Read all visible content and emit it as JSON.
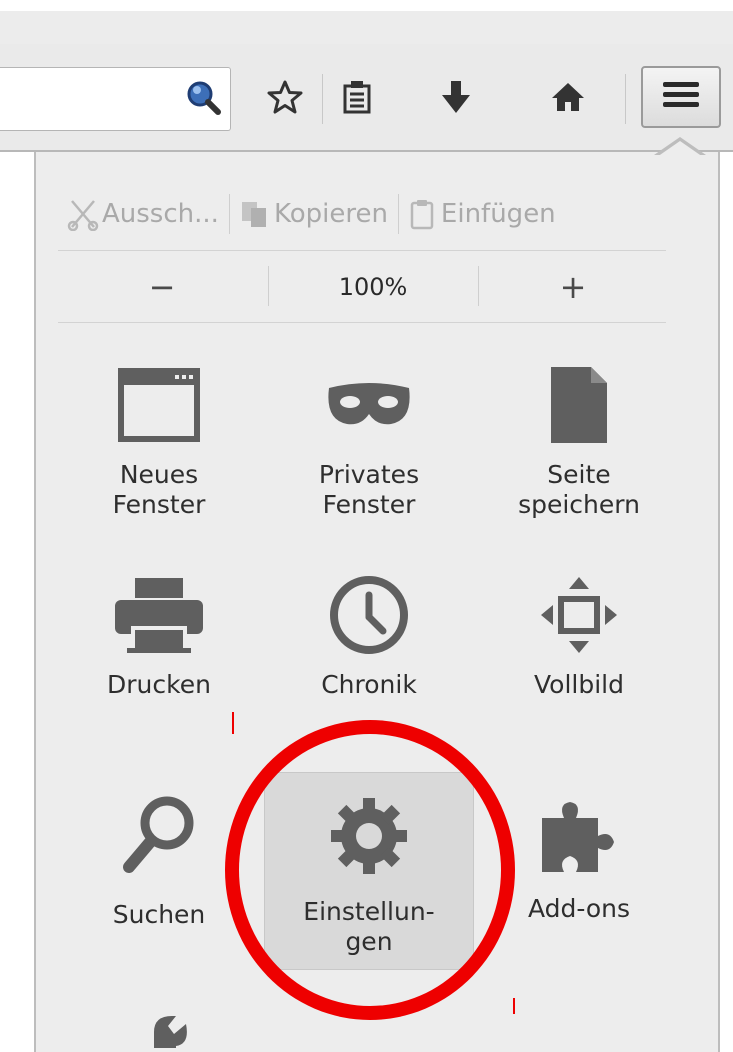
{
  "toolbar": {
    "search_icon": "magnifier-icon",
    "bookmark_star_icon": "star-icon",
    "reading_list_icon": "reading-list-icon",
    "downloads_icon": "download-arrow-icon",
    "home_icon": "home-icon",
    "menu_icon": "hamburger-icon"
  },
  "edit_controls": {
    "cut_label": "Aussch...",
    "copy_label": "Kopieren",
    "paste_label": "Einfügen"
  },
  "zoom_controls": {
    "zoom_out_label": "−",
    "zoom_level": "100%",
    "zoom_in_label": "+"
  },
  "menu_items": [
    {
      "label": "Neues\nFenster",
      "icon": "window-icon"
    },
    {
      "label": "Privates\nFenster",
      "icon": "mask-icon"
    },
    {
      "label": "Seite\nspeichern",
      "icon": "document-icon"
    },
    {
      "label": "Drucken",
      "icon": "printer-icon"
    },
    {
      "label": "Chronik",
      "icon": "clock-icon"
    },
    {
      "label": "Vollbild",
      "icon": "fullscreen-arrows-icon"
    },
    {
      "label": "Suchen",
      "icon": "search-icon"
    },
    {
      "label": "Einstellun-\ngen",
      "icon": "gear-icon",
      "selected": true
    },
    {
      "label": "Add-ons",
      "icon": "puzzle-icon"
    },
    {
      "label": "",
      "icon": "wrench-icon"
    }
  ],
  "annotation": {
    "highlight_color": "#ee0000",
    "shape": "circle"
  },
  "colors": {
    "panel_bg": "#ededed",
    "icon_gray": "#5f5f5f",
    "selected_bg": "#d9d9d9"
  }
}
